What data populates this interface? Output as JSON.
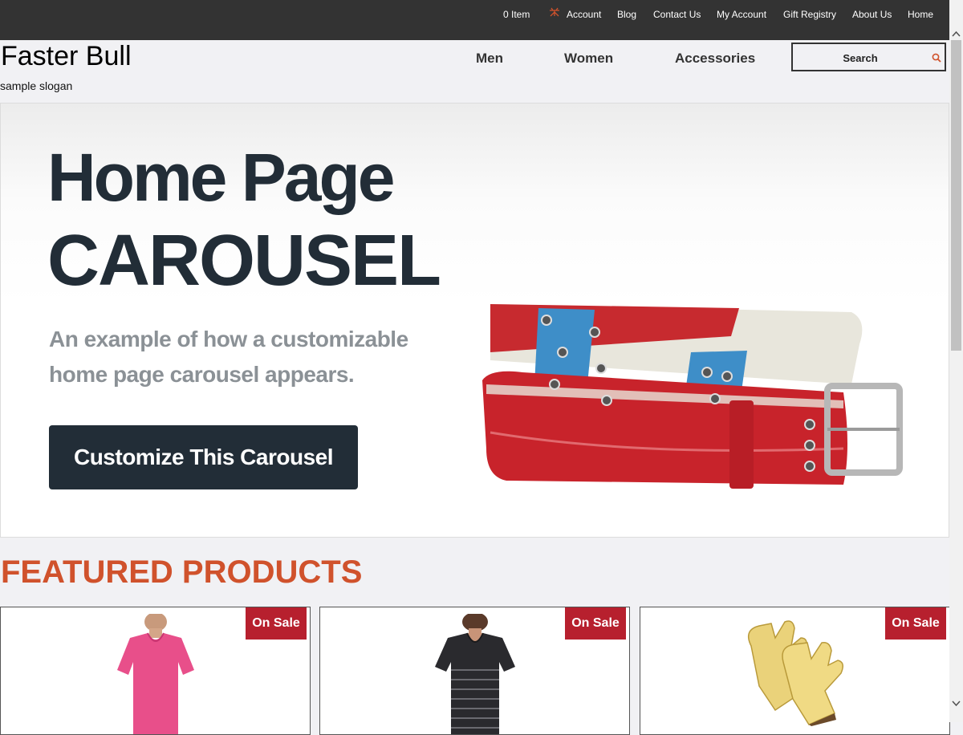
{
  "topbar": {
    "cart": "0 Item",
    "account": "Account",
    "links": [
      "Blog",
      "Contact Us",
      "My Account",
      "Gift Registry",
      "About Us",
      "Home"
    ]
  },
  "header": {
    "brand": "Faster Bull",
    "slogan": "sample slogan",
    "nav": [
      "Men",
      "Women",
      "Accessories"
    ],
    "search_placeholder": "Search"
  },
  "carousel": {
    "title_line1": "Home Page",
    "title_line2": "CAROUSEL",
    "subtitle": "An example of how a customizable home page carousel appears.",
    "button_label": "Customize This Carousel"
  },
  "featured": {
    "title": "FEATURED PRODUCTS",
    "products": [
      {
        "badge": "On Sale",
        "image": "pink-v-neck-tshirt"
      },
      {
        "badge": "On Sale",
        "image": "striped-v-neck-tshirt"
      },
      {
        "badge": "On Sale",
        "image": "leather-work-gloves"
      }
    ]
  },
  "colors": {
    "topbar_bg": "#333333",
    "accent": "#d0522c",
    "sale_badge": "#b7202e",
    "carousel_dark": "#222d37"
  }
}
